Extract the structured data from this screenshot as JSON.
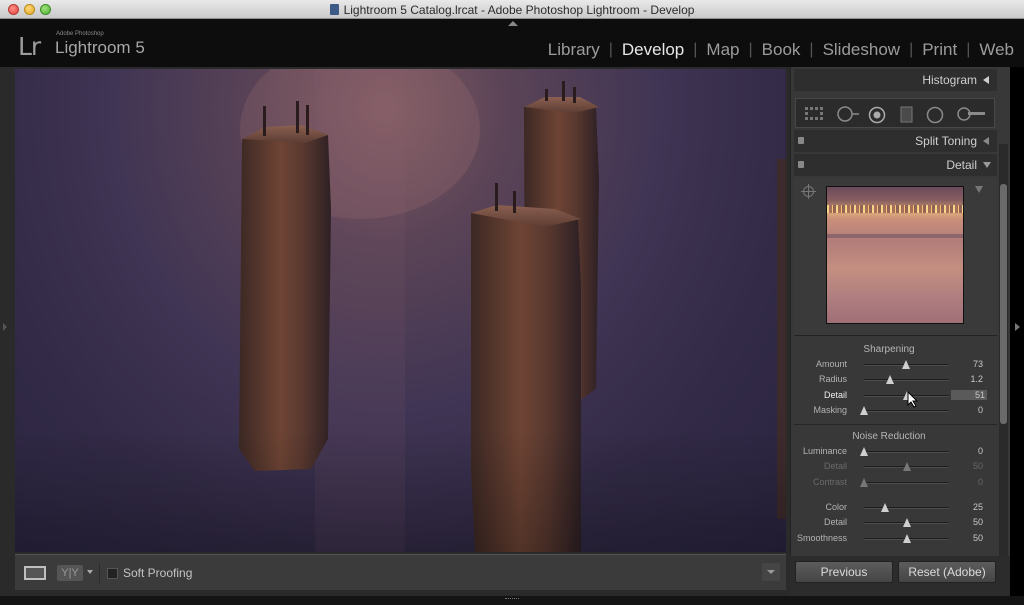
{
  "window": {
    "title": "Lightroom 5 Catalog.lrcat - Adobe Photoshop Lightroom - Develop"
  },
  "header": {
    "logo": "Lr",
    "brand_small": "Adobe Photoshop",
    "brand_name": "Lightroom 5",
    "modules": [
      {
        "label": "Library",
        "active": false
      },
      {
        "label": "Develop",
        "active": true
      },
      {
        "label": "Map",
        "active": false
      },
      {
        "label": "Book",
        "active": false
      },
      {
        "label": "Slideshow",
        "active": false
      },
      {
        "label": "Print",
        "active": false
      },
      {
        "label": "Web",
        "active": false
      }
    ]
  },
  "toolbar": {
    "yy_label": "Y|Y",
    "soft_proofing_label": "Soft Proofing",
    "soft_proofing_checked": false
  },
  "panels": {
    "histogram": {
      "label": "Histogram"
    },
    "split_toning": {
      "label": "Split Toning"
    },
    "detail": {
      "label": "Detail"
    }
  },
  "sharpening": {
    "title": "Sharpening",
    "sliders": [
      {
        "label": "Amount",
        "value": "73",
        "fraction": 0.49,
        "state": "normal"
      },
      {
        "label": "Radius",
        "value": "1.2",
        "fraction": 0.3,
        "state": "normal"
      },
      {
        "label": "Detail",
        "value": "51",
        "fraction": 0.51,
        "state": "active"
      },
      {
        "label": "Masking",
        "value": "0",
        "fraction": 0.0,
        "state": "normal"
      }
    ]
  },
  "noise_reduction": {
    "title": "Noise Reduction",
    "sliders": [
      {
        "label": "Luminance",
        "value": "0",
        "fraction": 0.0,
        "state": "normal"
      },
      {
        "label": "Detail",
        "value": "50",
        "fraction": 0.5,
        "state": "disabled"
      },
      {
        "label": "Contrast",
        "value": "0",
        "fraction": 0.0,
        "state": "disabled"
      },
      {
        "label": "Color",
        "value": "25",
        "fraction": 0.25,
        "state": "normal"
      },
      {
        "label": "Detail",
        "value": "50",
        "fraction": 0.5,
        "state": "normal"
      },
      {
        "label": "Smoothness",
        "value": "50",
        "fraction": 0.5,
        "state": "normal"
      }
    ]
  },
  "buttons": {
    "previous": "Previous",
    "reset": "Reset (Adobe)"
  },
  "colors": {
    "panel_bg": "#383838",
    "header_bg": "#0d0d0d",
    "active_module": "#e8e8e8"
  }
}
